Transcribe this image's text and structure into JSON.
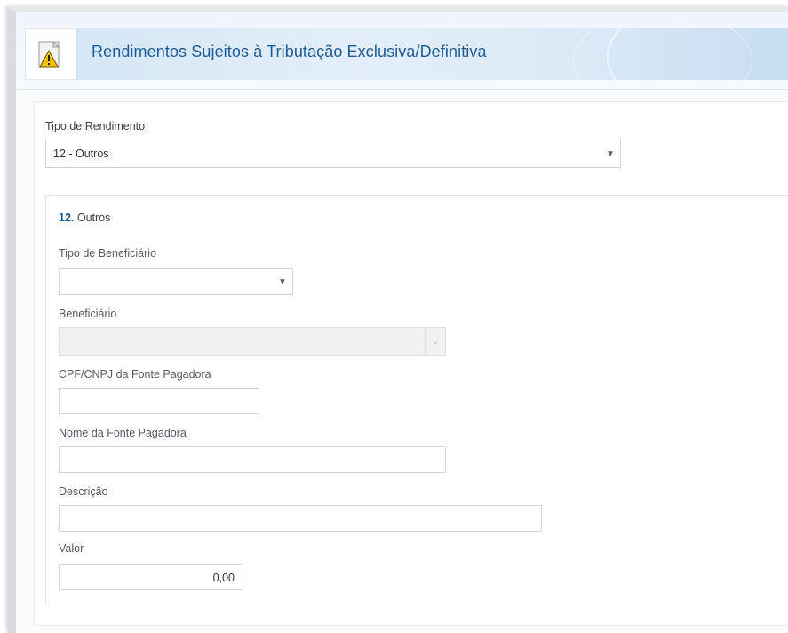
{
  "header": {
    "title": "Rendimentos Sujeitos à Tributação Exclusiva/Definitiva",
    "icon": "warning-document-icon"
  },
  "tipo_rendimento": {
    "label": "Tipo de Rendimento",
    "selected": "12 - Outros"
  },
  "section": {
    "number": "12.",
    "name": "Outros"
  },
  "fields": {
    "tipo_beneficiario_label": "Tipo de Beneficiário",
    "tipo_beneficiario_value": "",
    "beneficiario_label": "Beneficiário",
    "beneficiario_value": "",
    "cpf_cnpj_label": "CPF/CNPJ da Fonte Pagadora",
    "cpf_cnpj_value": "",
    "nome_fonte_label": "Nome da Fonte Pagadora",
    "nome_fonte_value": "",
    "descricao_label": "Descrição",
    "descricao_value": "",
    "valor_label": "Valor",
    "valor_value": "0,00"
  },
  "colors": {
    "title": "#1d5b96",
    "accent_band": "#d5e7f6",
    "icon_yellow": "#f2c200"
  }
}
